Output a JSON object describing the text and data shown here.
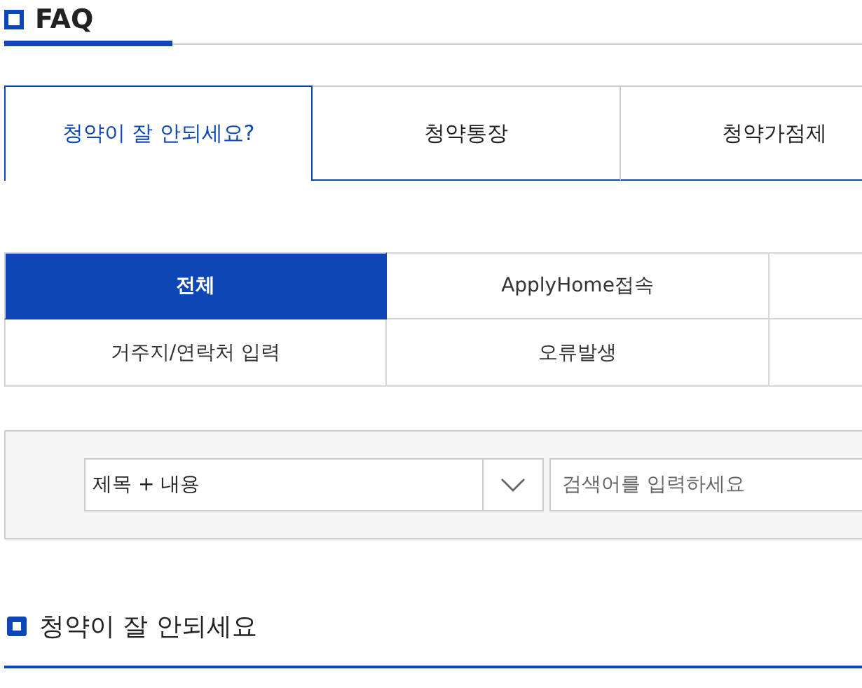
{
  "page_title": "FAQ",
  "tabs": [
    {
      "label": "청약이 잘 안되세요?",
      "selected": true
    },
    {
      "label": "청약통장",
      "selected": false
    },
    {
      "label": "청약가점제",
      "selected": false
    }
  ],
  "categories": [
    {
      "label": "전체",
      "selected": true
    },
    {
      "label": "ApplyHome접속",
      "selected": false
    },
    {
      "label": "거주지/연락처 입력",
      "selected": false
    },
    {
      "label": "오류발생",
      "selected": false
    }
  ],
  "search": {
    "scope": "제목 + 내용",
    "placeholder": "검색어를 입력하세요"
  },
  "section_title": "청약이 잘 안되세요"
}
